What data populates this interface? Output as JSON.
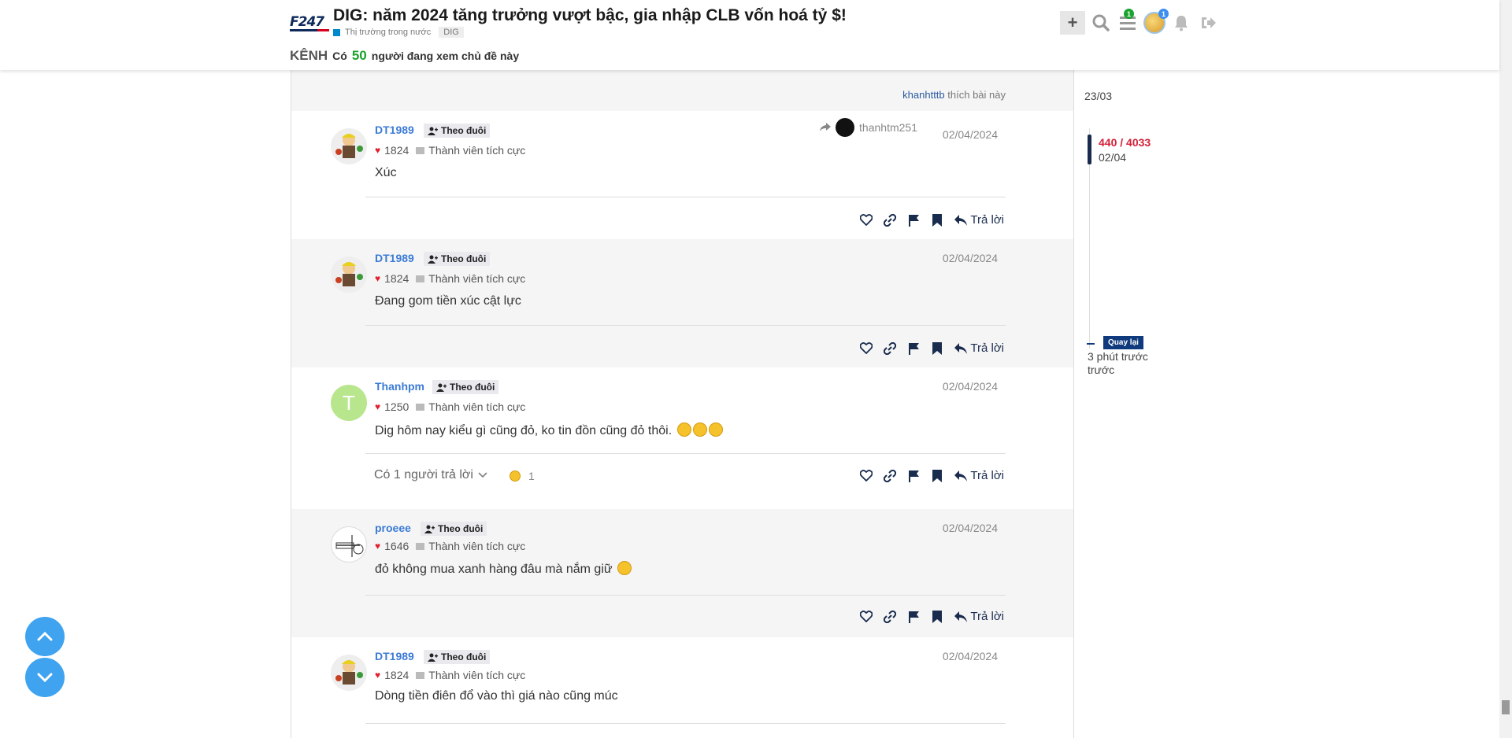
{
  "header": {
    "logo_text": "F247",
    "title": "DIG: năm 2024 tăng trưởng vượt bậc, gia nhập CLB vốn hoá tỷ $!",
    "category": "Thị trường trong nước",
    "tag": "DIG",
    "viewers_prefix": "KÊNH",
    "viewers_co": "Có",
    "viewers_count": "50",
    "viewers_suffix": "người đang xem chủ đề này",
    "menu_badge": "1",
    "avatar_badge": "1",
    "accent_color": "#3b7bd6"
  },
  "previous": {
    "liker": "khanhtttb",
    "likes_suffix": "thích bài này"
  },
  "posts": [
    {
      "username": "DT1989",
      "follow_label": "Theo đuôi",
      "likes": "1824",
      "rank": "Thành viên tích cực",
      "reply_to": "thanhtm251",
      "date": "02/04/2024",
      "content": "Xúc",
      "reply_label": "Trả lời"
    },
    {
      "username": "DT1989",
      "follow_label": "Theo đuôi",
      "likes": "1824",
      "rank": "Thành viên tích cực",
      "date": "02/04/2024",
      "content": "Đang gom tiền xúc cật lực",
      "reply_label": "Trả lời"
    },
    {
      "username": "Thanhpm",
      "avatar_letter": "T",
      "follow_label": "Theo đuôi",
      "likes": "1250",
      "rank": "Thành viên tích cực",
      "date": "02/04/2024",
      "content": "Dig hôm nay kiểu gì cũng đỏ, ko tin đồn cũng đỏ thôi.",
      "replies_label": "Có 1 người trả lời",
      "reaction_count": "1",
      "reply_label": "Trả lời"
    },
    {
      "username": "proeee",
      "follow_label": "Theo đuôi",
      "likes": "1646",
      "rank": "Thành viên tích cực",
      "date": "02/04/2024",
      "content": "đỏ không mua xanh hàng đâu mà nắm giữ",
      "reply_label": "Trả lời"
    },
    {
      "username": "DT1989",
      "follow_label": "Theo đuôi",
      "likes": "1824",
      "rank": "Thành viên tích cực",
      "date": "02/04/2024",
      "content": "Dòng tiền điên đổ vào thì giá nào cũng múc"
    }
  ],
  "timeline": {
    "start_date": "23/03",
    "position": "440 / 4033",
    "position_date": "02/04",
    "back_label": "Quay lại",
    "end_label_1": "3 phút trước",
    "end_label_2": "trước"
  }
}
